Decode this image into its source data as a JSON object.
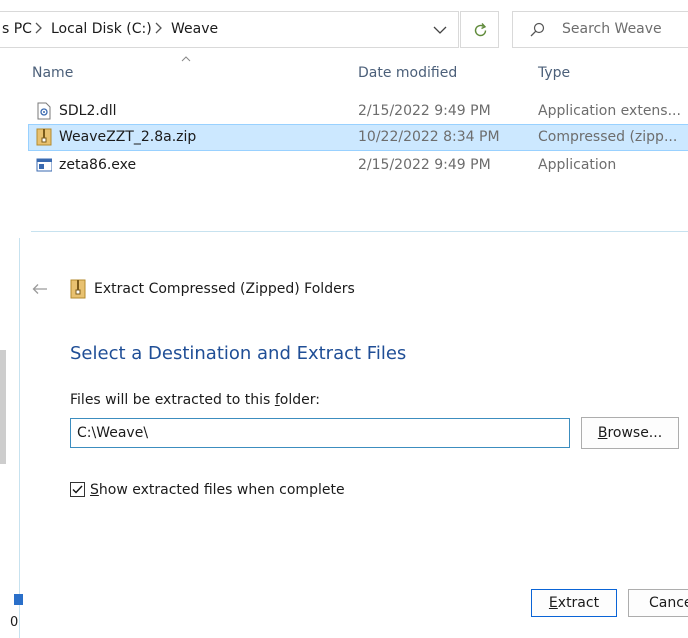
{
  "breadcrumb": {
    "items": [
      "s PC",
      "Local Disk (C:)",
      "Weave"
    ]
  },
  "search": {
    "placeholder": "Search Weave"
  },
  "columns": {
    "name": "Name",
    "date": "Date modified",
    "type": "Type"
  },
  "files": [
    {
      "name": "SDL2.dll",
      "date": "2/15/2022 9:49 PM",
      "type": "Application extens...",
      "icon": "dll-file-icon",
      "selected": false
    },
    {
      "name": "WeaveZZT_2.8a.zip",
      "date": "10/22/2022 8:34 PM",
      "type": "Compressed (zipp...",
      "icon": "zip-folder-icon",
      "selected": true
    },
    {
      "name": "zeta86.exe",
      "date": "2/15/2022 9:49 PM",
      "type": "Application",
      "icon": "exe-file-icon",
      "selected": false
    }
  ],
  "wizard": {
    "title": "Extract Compressed (Zipped) Folders",
    "heading": "Select a Destination and Extract Files",
    "folder_label_pre": "Files will be extracted to this ",
    "folder_label_key": "f",
    "folder_label_post": "older:",
    "path_value": "C:\\Weave\\",
    "browse_key": "B",
    "browse_post": "rowse...",
    "checkbox_key": "S",
    "checkbox_post": "how extracted files when complete",
    "checkbox_checked": true,
    "extract_key": "E",
    "extract_post": "xtract",
    "cancel_label": "Cance"
  },
  "misc": {
    "bottom_left_text": "0"
  },
  "colors": {
    "selection_bg": "#cce8ff",
    "heading_blue": "#1f4e96",
    "header_text": "#4c607a"
  }
}
